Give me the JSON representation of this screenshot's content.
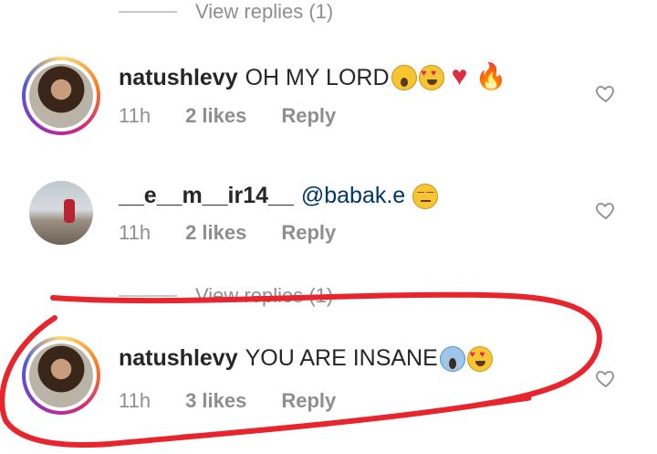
{
  "view_replies_1": {
    "label": "View replies (1)"
  },
  "comments": [
    {
      "username": "natushlevy",
      "text": "OH MY LORD",
      "time": "11h",
      "likes": "2 likes",
      "reply": "Reply",
      "emojis": [
        "hushed-face-emoji",
        "heart-eyes-emoji",
        "red-heart-emoji",
        "fire-emoji"
      ]
    },
    {
      "username": "__e__m__ir14__",
      "mention": "@babak.e",
      "time": "11h",
      "likes": "2 likes",
      "reply": "Reply",
      "emojis": [
        "expressionless-face-emoji"
      ]
    },
    {
      "username": "natushlevy",
      "text": "YOU ARE INSANE",
      "time": "11h",
      "likes": "3 likes",
      "reply": "Reply",
      "emojis": [
        "screaming-face-emoji",
        "heart-eyes-emoji"
      ]
    }
  ],
  "view_replies_2": {
    "label": "View replies (1)"
  },
  "colors": {
    "mention": "#003569",
    "muted": "#8e8e8e",
    "scribble": "#e8242c"
  },
  "icons": {
    "like": "heart-outline-icon"
  }
}
